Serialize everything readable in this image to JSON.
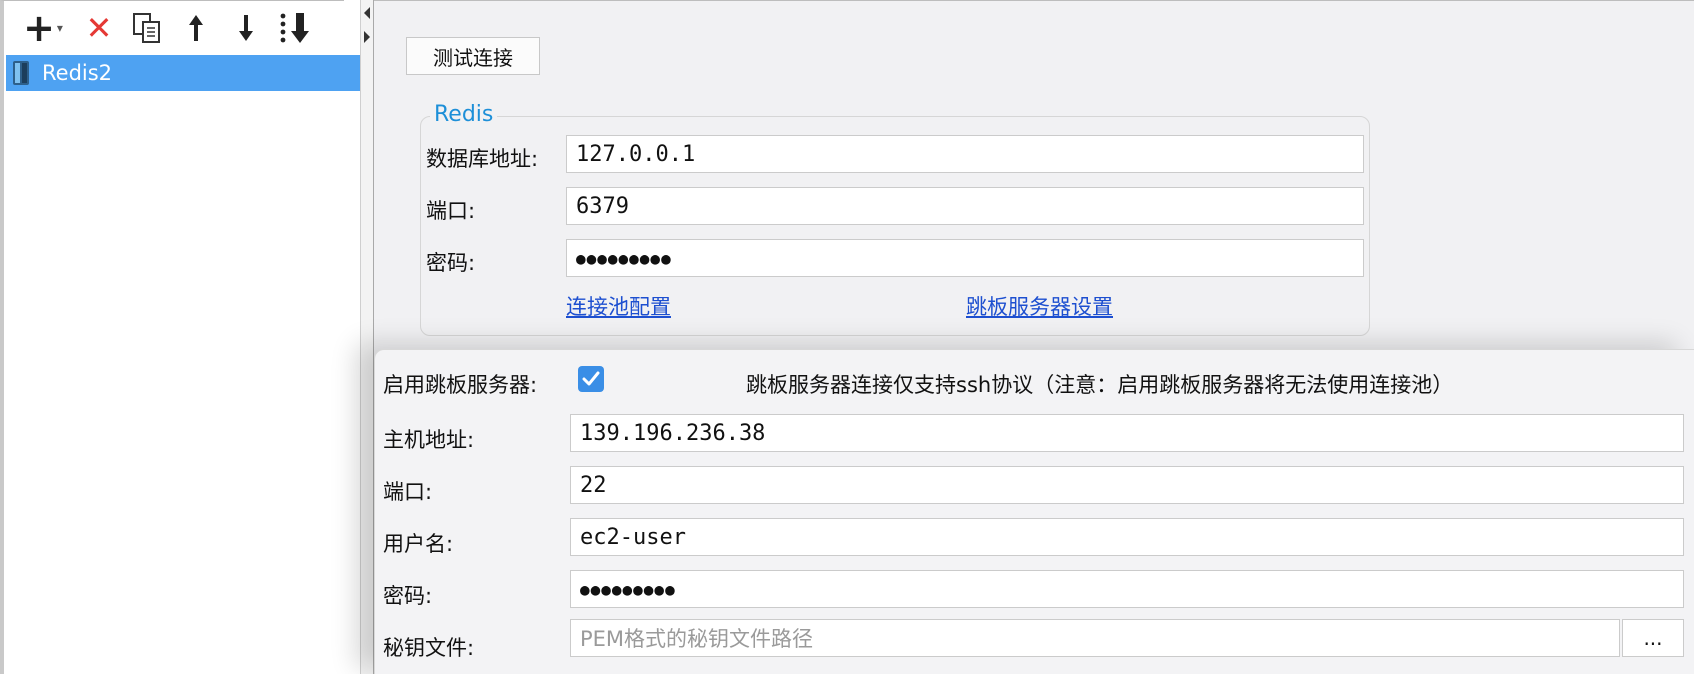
{
  "toolbar": {
    "add": "+",
    "add_dropdown": "▾",
    "delete": "✕"
  },
  "tree": {
    "items": [
      {
        "label": "Redis2"
      }
    ]
  },
  "actions": {
    "test_connection": "测试连接"
  },
  "redis": {
    "group_title": "Redis",
    "host_label": "数据库地址:",
    "host_value": "127.0.0.1",
    "port_label": "端口:",
    "port_value": "6379",
    "password_label": "密码:",
    "password_value": "●●●●●●●●●",
    "pool_config_link": "连接池配置",
    "jump_server_link": "跳板服务器设置"
  },
  "ssh": {
    "enable_label": "启用跳板服务器:",
    "enabled": true,
    "note": "跳板服务器连接仅支持ssh协议（注意：启用跳板服务器将无法使用连接池）",
    "host_label": "主机地址:",
    "host_value": "139.196.236.38",
    "port_label": "端口:",
    "port_value": "22",
    "user_label": "用户名:",
    "user_value": "ec2-user",
    "password_label": "密码:",
    "password_value": "●●●●●●●●●",
    "key_label": "秘钥文件:",
    "key_placeholder": "PEM格式的秘钥文件路径",
    "browse": "..."
  },
  "colors": {
    "selection": "#4ea2f2",
    "group_title": "#1d8fd8",
    "link": "#1d4fd0",
    "checkbox": "#3a8ee6",
    "delete_icon": "#e53935"
  }
}
